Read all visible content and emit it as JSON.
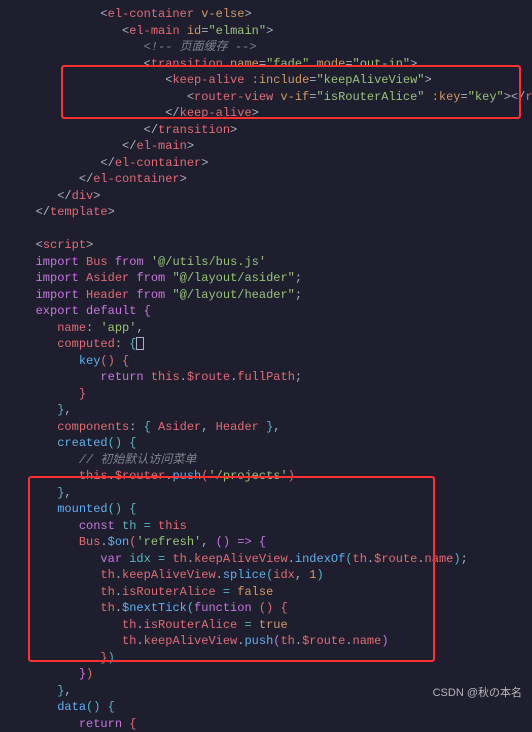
{
  "lines": [
    {
      "indent": 4,
      "tokens": [
        {
          "t": "<",
          "c": "brkt"
        },
        {
          "t": "el-container",
          "c": "tag"
        },
        {
          "t": " ",
          "c": ""
        },
        {
          "t": "v-else",
          "c": "attr"
        },
        {
          "t": ">",
          "c": "brkt"
        }
      ]
    },
    {
      "indent": 5,
      "tokens": [
        {
          "t": "<",
          "c": "brkt"
        },
        {
          "t": "el-main",
          "c": "tag"
        },
        {
          "t": " ",
          "c": ""
        },
        {
          "t": "id",
          "c": "attr"
        },
        {
          "t": "=",
          "c": "punct"
        },
        {
          "t": "\"elmain\"",
          "c": "str"
        },
        {
          "t": ">",
          "c": "brkt"
        }
      ]
    },
    {
      "indent": 6,
      "tokens": [
        {
          "t": "<!-- 页面缓存 -->",
          "c": "comment-cn"
        }
      ]
    },
    {
      "indent": 6,
      "tokens": [
        {
          "t": "<",
          "c": "brkt"
        },
        {
          "t": "transition",
          "c": "tag"
        },
        {
          "t": " ",
          "c": ""
        },
        {
          "t": "name",
          "c": "attr"
        },
        {
          "t": "=",
          "c": "punct"
        },
        {
          "t": "\"fade\"",
          "c": "str"
        },
        {
          "t": " ",
          "c": ""
        },
        {
          "t": "mode",
          "c": "attr"
        },
        {
          "t": "=",
          "c": "punct"
        },
        {
          "t": "\"out-in\"",
          "c": "str"
        },
        {
          "t": ">",
          "c": "brkt"
        }
      ]
    },
    {
      "indent": 7,
      "tokens": [
        {
          "t": "<",
          "c": "brkt"
        },
        {
          "t": "keep-alive",
          "c": "tag"
        },
        {
          "t": " ",
          "c": ""
        },
        {
          "t": ":include",
          "c": "attr"
        },
        {
          "t": "=",
          "c": "punct"
        },
        {
          "t": "\"keepAliveView\"",
          "c": "str"
        },
        {
          "t": ">",
          "c": "brkt"
        }
      ]
    },
    {
      "indent": 8,
      "tokens": [
        {
          "t": "<",
          "c": "brkt"
        },
        {
          "t": "router-view",
          "c": "tag"
        },
        {
          "t": " ",
          "c": ""
        },
        {
          "t": "v-if",
          "c": "attr"
        },
        {
          "t": "=",
          "c": "punct"
        },
        {
          "t": "\"isRouterAlice\"",
          "c": "str"
        },
        {
          "t": " ",
          "c": ""
        },
        {
          "t": ":key",
          "c": "attr"
        },
        {
          "t": "=",
          "c": "punct"
        },
        {
          "t": "\"key\"",
          "c": "str"
        },
        {
          "t": "></",
          "c": "brkt"
        },
        {
          "t": "router-view",
          "c": "tag"
        },
        {
          "t": ">",
          "c": "brkt"
        }
      ]
    },
    {
      "indent": 7,
      "tokens": [
        {
          "t": "</",
          "c": "brkt"
        },
        {
          "t": "keep-alive",
          "c": "tag"
        },
        {
          "t": ">",
          "c": "brkt"
        }
      ]
    },
    {
      "indent": 6,
      "tokens": [
        {
          "t": "</",
          "c": "brkt"
        },
        {
          "t": "transition",
          "c": "tag"
        },
        {
          "t": ">",
          "c": "brkt"
        }
      ]
    },
    {
      "indent": 5,
      "tokens": [
        {
          "t": "</",
          "c": "brkt"
        },
        {
          "t": "el-main",
          "c": "tag"
        },
        {
          "t": ">",
          "c": "brkt"
        }
      ]
    },
    {
      "indent": 4,
      "tokens": [
        {
          "t": "</",
          "c": "brkt"
        },
        {
          "t": "el-container",
          "c": "tag"
        },
        {
          "t": ">",
          "c": "brkt"
        }
      ]
    },
    {
      "indent": 3,
      "tokens": [
        {
          "t": "</",
          "c": "brkt"
        },
        {
          "t": "el-container",
          "c": "tag"
        },
        {
          "t": ">",
          "c": "brkt"
        }
      ]
    },
    {
      "indent": 2,
      "tokens": [
        {
          "t": "</",
          "c": "brkt"
        },
        {
          "t": "div",
          "c": "tag"
        },
        {
          "t": ">",
          "c": "brkt"
        }
      ]
    },
    {
      "indent": 1,
      "tokens": [
        {
          "t": "</",
          "c": "brkt"
        },
        {
          "t": "template",
          "c": "tag"
        },
        {
          "t": ">",
          "c": "brkt"
        }
      ]
    },
    {
      "indent": 0,
      "tokens": []
    },
    {
      "indent": 1,
      "tokens": [
        {
          "t": "<",
          "c": "brkt"
        },
        {
          "t": "script",
          "c": "tag"
        },
        {
          "t": ">",
          "c": "brkt"
        }
      ]
    },
    {
      "indent": 1,
      "tokens": [
        {
          "t": "import",
          "c": "kw"
        },
        {
          "t": " Bus ",
          "c": "prop"
        },
        {
          "t": "from",
          "c": "kw"
        },
        {
          "t": " ",
          "c": ""
        },
        {
          "t": "'@/utils/bus.js'",
          "c": "str"
        }
      ]
    },
    {
      "indent": 1,
      "tokens": [
        {
          "t": "import",
          "c": "kw"
        },
        {
          "t": " Asider ",
          "c": "prop"
        },
        {
          "t": "from",
          "c": "kw"
        },
        {
          "t": " ",
          "c": ""
        },
        {
          "t": "\"@/layout/asider\"",
          "c": "str"
        },
        {
          "t": ";",
          "c": "punct"
        }
      ]
    },
    {
      "indent": 1,
      "tokens": [
        {
          "t": "import",
          "c": "kw"
        },
        {
          "t": " Header ",
          "c": "prop"
        },
        {
          "t": "from",
          "c": "kw"
        },
        {
          "t": " ",
          "c": ""
        },
        {
          "t": "\"@/layout/header\"",
          "c": "str"
        },
        {
          "t": ";",
          "c": "punct"
        }
      ]
    },
    {
      "indent": 1,
      "tokens": [
        {
          "t": "export",
          "c": "kw"
        },
        {
          "t": " ",
          "c": ""
        },
        {
          "t": "default",
          "c": "kw"
        },
        {
          "t": " ",
          "c": ""
        },
        {
          "t": "{",
          "c": "brkt-y"
        }
      ]
    },
    {
      "indent": 2,
      "tokens": [
        {
          "t": "name",
          "c": "prop"
        },
        {
          "t": ": ",
          "c": "punct"
        },
        {
          "t": "'app'",
          "c": "str"
        },
        {
          "t": ",",
          "c": "punct"
        }
      ]
    },
    {
      "indent": 2,
      "tokens": [
        {
          "t": "computed",
          "c": "prop"
        },
        {
          "t": ": ",
          "c": "punct"
        },
        {
          "t": "{",
          "c": "brkt-b"
        },
        {
          "t": "[CURSOR]",
          "c": ""
        }
      ]
    },
    {
      "indent": 3,
      "tokens": [
        {
          "t": "key",
          "c": "fn"
        },
        {
          "t": "()",
          "c": "brkt-p"
        },
        {
          "t": " ",
          "c": ""
        },
        {
          "t": "{",
          "c": "brkt-p"
        }
      ]
    },
    {
      "indent": 4,
      "tokens": [
        {
          "t": "return",
          "c": "kw"
        },
        {
          "t": " ",
          "c": ""
        },
        {
          "t": "this",
          "c": "this"
        },
        {
          "t": ".",
          "c": "punct"
        },
        {
          "t": "$route",
          "c": "prop"
        },
        {
          "t": ".",
          "c": "punct"
        },
        {
          "t": "fullPath",
          "c": "prop"
        },
        {
          "t": ";",
          "c": "punct"
        }
      ]
    },
    {
      "indent": 3,
      "tokens": [
        {
          "t": "}",
          "c": "brkt-p"
        }
      ]
    },
    {
      "indent": 2,
      "tokens": [
        {
          "t": "}",
          "c": "brkt-b"
        },
        {
          "t": ",",
          "c": "punct"
        }
      ]
    },
    {
      "indent": 2,
      "tokens": [
        {
          "t": "components",
          "c": "prop"
        },
        {
          "t": ": ",
          "c": "punct"
        },
        {
          "t": "{",
          "c": "brkt-b"
        },
        {
          "t": " Asider",
          "c": "prop"
        },
        {
          "t": ",",
          "c": "punct"
        },
        {
          "t": " Header ",
          "c": "prop"
        },
        {
          "t": "}",
          "c": "brkt-b"
        },
        {
          "t": ",",
          "c": "punct"
        }
      ]
    },
    {
      "indent": 2,
      "tokens": [
        {
          "t": "created",
          "c": "fn"
        },
        {
          "t": "()",
          "c": "brkt-b"
        },
        {
          "t": " ",
          "c": ""
        },
        {
          "t": "{",
          "c": "brkt-b"
        }
      ]
    },
    {
      "indent": 3,
      "tokens": [
        {
          "t": "// 初始默认访问菜单",
          "c": "comment-cn"
        }
      ]
    },
    {
      "indent": 3,
      "tokens": [
        {
          "t": "this",
          "c": "this"
        },
        {
          "t": ".",
          "c": "punct"
        },
        {
          "t": "$router",
          "c": "prop"
        },
        {
          "t": ".",
          "c": "punct"
        },
        {
          "t": "push",
          "c": "fn"
        },
        {
          "t": "(",
          "c": "brkt-p"
        },
        {
          "t": "'/projects'",
          "c": "str"
        },
        {
          "t": ")",
          "c": "brkt-p"
        }
      ]
    },
    {
      "indent": 2,
      "tokens": [
        {
          "t": "}",
          "c": "brkt-b"
        },
        {
          "t": ",",
          "c": "punct"
        }
      ]
    },
    {
      "indent": 2,
      "tokens": [
        {
          "t": "mounted",
          "c": "fn"
        },
        {
          "t": "()",
          "c": "brkt-b"
        },
        {
          "t": " ",
          "c": ""
        },
        {
          "t": "{",
          "c": "brkt-b"
        }
      ]
    },
    {
      "indent": 3,
      "tokens": [
        {
          "t": "const",
          "c": "kw"
        },
        {
          "t": " th ",
          "c": "var"
        },
        {
          "t": "=",
          "c": "sym"
        },
        {
          "t": " ",
          "c": ""
        },
        {
          "t": "this",
          "c": "this"
        }
      ]
    },
    {
      "indent": 3,
      "tokens": [
        {
          "t": "Bus",
          "c": "prop"
        },
        {
          "t": ".",
          "c": "punct"
        },
        {
          "t": "$on",
          "c": "fn"
        },
        {
          "t": "(",
          "c": "brkt-p"
        },
        {
          "t": "'refresh'",
          "c": "str"
        },
        {
          "t": ",",
          "c": "punct"
        },
        {
          "t": " ",
          "c": ""
        },
        {
          "t": "()",
          "c": "brkt-y"
        },
        {
          "t": " ",
          "c": ""
        },
        {
          "t": "=>",
          "c": "kw"
        },
        {
          "t": " ",
          "c": ""
        },
        {
          "t": "{",
          "c": "brkt-y"
        }
      ]
    },
    {
      "indent": 4,
      "tokens": [
        {
          "t": "var",
          "c": "kw"
        },
        {
          "t": " idx ",
          "c": "var"
        },
        {
          "t": "=",
          "c": "sym"
        },
        {
          "t": " th",
          "c": "prop"
        },
        {
          "t": ".",
          "c": "punct"
        },
        {
          "t": "keepAliveView",
          "c": "prop"
        },
        {
          "t": ".",
          "c": "punct"
        },
        {
          "t": "indexOf",
          "c": "fn"
        },
        {
          "t": "(",
          "c": "brkt-b"
        },
        {
          "t": "th",
          "c": "prop"
        },
        {
          "t": ".",
          "c": "punct"
        },
        {
          "t": "$route",
          "c": "prop"
        },
        {
          "t": ".",
          "c": "punct"
        },
        {
          "t": "name",
          "c": "prop"
        },
        {
          "t": ")",
          "c": "brkt-b"
        },
        {
          "t": ";",
          "c": "punct"
        }
      ]
    },
    {
      "indent": 4,
      "tokens": [
        {
          "t": "th",
          "c": "prop"
        },
        {
          "t": ".",
          "c": "punct"
        },
        {
          "t": "keepAliveView",
          "c": "prop"
        },
        {
          "t": ".",
          "c": "punct"
        },
        {
          "t": "splice",
          "c": "fn"
        },
        {
          "t": "(",
          "c": "brkt-b"
        },
        {
          "t": "idx",
          "c": "prop"
        },
        {
          "t": ",",
          "c": "punct"
        },
        {
          "t": " ",
          "c": ""
        },
        {
          "t": "1",
          "c": "num"
        },
        {
          "t": ")",
          "c": "brkt-b"
        }
      ]
    },
    {
      "indent": 4,
      "tokens": [
        {
          "t": "th",
          "c": "prop"
        },
        {
          "t": ".",
          "c": "punct"
        },
        {
          "t": "isRouterAlice",
          "c": "prop"
        },
        {
          "t": " ",
          "c": ""
        },
        {
          "t": "=",
          "c": "sym"
        },
        {
          "t": " ",
          "c": ""
        },
        {
          "t": "false",
          "c": "bool"
        }
      ]
    },
    {
      "indent": 4,
      "tokens": [
        {
          "t": "th",
          "c": "prop"
        },
        {
          "t": ".",
          "c": "punct"
        },
        {
          "t": "$nextTick",
          "c": "fn"
        },
        {
          "t": "(",
          "c": "brkt-b"
        },
        {
          "t": "function",
          "c": "kw"
        },
        {
          "t": " ",
          "c": ""
        },
        {
          "t": "()",
          "c": "brkt-p"
        },
        {
          "t": " ",
          "c": ""
        },
        {
          "t": "{",
          "c": "brkt-p"
        }
      ]
    },
    {
      "indent": 5,
      "tokens": [
        {
          "t": "th",
          "c": "prop"
        },
        {
          "t": ".",
          "c": "punct"
        },
        {
          "t": "isRouterAlice",
          "c": "prop"
        },
        {
          "t": " ",
          "c": ""
        },
        {
          "t": "=",
          "c": "sym"
        },
        {
          "t": " ",
          "c": ""
        },
        {
          "t": "true",
          "c": "bool"
        }
      ]
    },
    {
      "indent": 5,
      "tokens": [
        {
          "t": "th",
          "c": "prop"
        },
        {
          "t": ".",
          "c": "punct"
        },
        {
          "t": "keepAliveView",
          "c": "prop"
        },
        {
          "t": ".",
          "c": "punct"
        },
        {
          "t": "push",
          "c": "fn"
        },
        {
          "t": "(",
          "c": "brkt-y"
        },
        {
          "t": "th",
          "c": "prop"
        },
        {
          "t": ".",
          "c": "punct"
        },
        {
          "t": "$route",
          "c": "prop"
        },
        {
          "t": ".",
          "c": "punct"
        },
        {
          "t": "name",
          "c": "prop"
        },
        {
          "t": ")",
          "c": "brkt-y"
        }
      ]
    },
    {
      "indent": 4,
      "tokens": [
        {
          "t": "}",
          "c": "brkt-p"
        },
        {
          "t": ")",
          "c": "brkt-b"
        }
      ]
    },
    {
      "indent": 3,
      "tokens": [
        {
          "t": "}",
          "c": "brkt-y"
        },
        {
          "t": ")",
          "c": "brkt-p"
        }
      ]
    },
    {
      "indent": 2,
      "tokens": [
        {
          "t": "}",
          "c": "brkt-b"
        },
        {
          "t": ",",
          "c": "punct"
        }
      ]
    },
    {
      "indent": 2,
      "tokens": [
        {
          "t": "data",
          "c": "fn"
        },
        {
          "t": "()",
          "c": "brkt-b"
        },
        {
          "t": " ",
          "c": ""
        },
        {
          "t": "{",
          "c": "brkt-b"
        }
      ]
    },
    {
      "indent": 3,
      "tokens": [
        {
          "t": "return",
          "c": "kw"
        },
        {
          "t": " ",
          "c": ""
        },
        {
          "t": "{",
          "c": "brkt-p"
        }
      ]
    }
  ],
  "watermark": "CSDN @秋の本名"
}
